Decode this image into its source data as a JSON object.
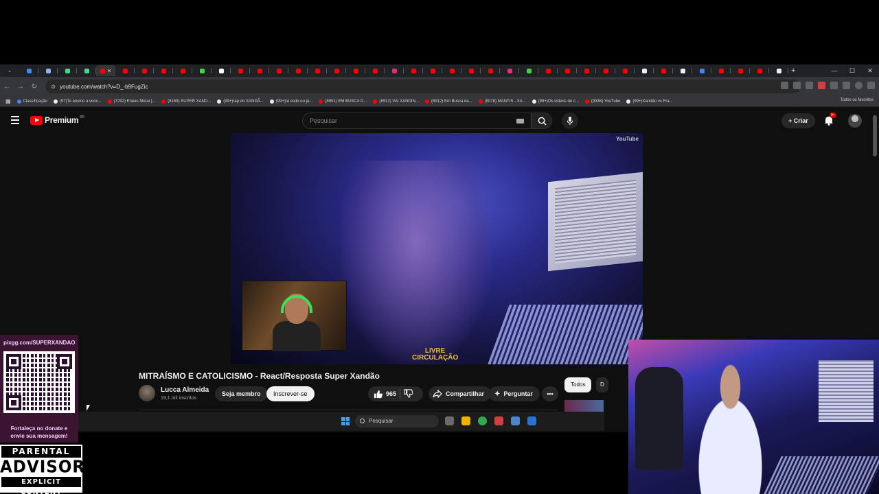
{
  "browser": {
    "url": "youtube.com/watch?v=D_-b9FugZic",
    "bookmarks": [
      {
        "label": "Classificação",
        "color": "#4285f4"
      },
      {
        "label": "(97)Te ensino a venc...",
        "color": "#eee"
      },
      {
        "label": "(7292) Enéas Metal |...",
        "color": "#ff0000"
      },
      {
        "label": "(8159) SUPER XAND...",
        "color": "#ff0000"
      },
      {
        "label": "(99+)rap do XANDÃ...",
        "color": "#eee"
      },
      {
        "label": "(99+)tá cedo ou já...",
        "color": "#eee"
      },
      {
        "label": "(8851) EM BUSCA D...",
        "color": "#ff0000"
      },
      {
        "label": "(8912) VAI XANDIN...",
        "color": "#ff0000"
      },
      {
        "label": "(8912) Em Busca da...",
        "color": "#ff0000"
      },
      {
        "label": "(9078) MANTIS - XA...",
        "color": "#ff0000"
      },
      {
        "label": "(99+)Os vídeos de c...",
        "color": "#eee"
      },
      {
        "label": "(9338) YouTube",
        "color": "#ff0000"
      },
      {
        "label": "(99+)Xandão vs Fra...",
        "color": "#eee"
      }
    ],
    "all_bookmarks_label": "Todos os favoritos",
    "tab_colors": [
      "#4285f4",
      "#8ab4f8",
      "#3ddc84",
      "#3ddc84",
      "#ff0000",
      "#ff0000",
      "#ff0000",
      "#ff0000",
      "#ff0000",
      "#42d242",
      "#ffffff",
      "#ff0000",
      "#ff0000",
      "#ff0000",
      "#ff0000",
      "#ff0000",
      "#ff0000",
      "#ff0000",
      "#ff0000",
      "#e1306c",
      "#ff0000",
      "#ff0000",
      "#ff0000",
      "#ff0000",
      "#ff0000",
      "#e1306c",
      "#42d242",
      "#ff0000",
      "#ff0000",
      "#ff0000",
      "#ff0000",
      "#ff0000",
      "#eeeeee",
      "#ff0000",
      "#eeeeee",
      "#4285f4",
      "#ff0000",
      "#ff0000",
      "#ff0000",
      "#eeeeee"
    ]
  },
  "youtube": {
    "logo_text": "Premium",
    "country_code": "BR",
    "search_placeholder": "Pesquisar",
    "create_label": "Criar",
    "notifications_badge": "9+",
    "video_watermark": "YouTube",
    "video_overlay_text_1": "LIVRE",
    "video_overlay_text_2": "CIRCULAÇÃO",
    "title": "MITRAÍSMO E CATOLICISMO - React/Resposta Super Xandão",
    "channel_name": "Lucca Almeida",
    "channel_subs": "19,1 mil inscritos",
    "join_label": "Seja membro",
    "subscribe_label": "Inscrever-se",
    "likes": "965",
    "share_label": "Compartilhar",
    "ask_label": "Perguntar",
    "chip_all": "Todos",
    "chip_next": "D"
  },
  "taskbar": {
    "search_placeholder": "Pesquisar",
    "app_colors": [
      "#6b6b6b",
      "#f0b400",
      "#34a853",
      "#d04040",
      "#4b86c8",
      "#2a72d0"
    ]
  },
  "overlay": {
    "pix_url": "pixgg.com/SUPERXANDAO",
    "pix_message_1": "Fortaleça no donate e",
    "pix_message_2": "envie sua mensagem!",
    "advisory_1": "PARENTAL",
    "advisory_2": "ADVISORY",
    "advisory_3": "EXPLICIT CONTENT"
  }
}
